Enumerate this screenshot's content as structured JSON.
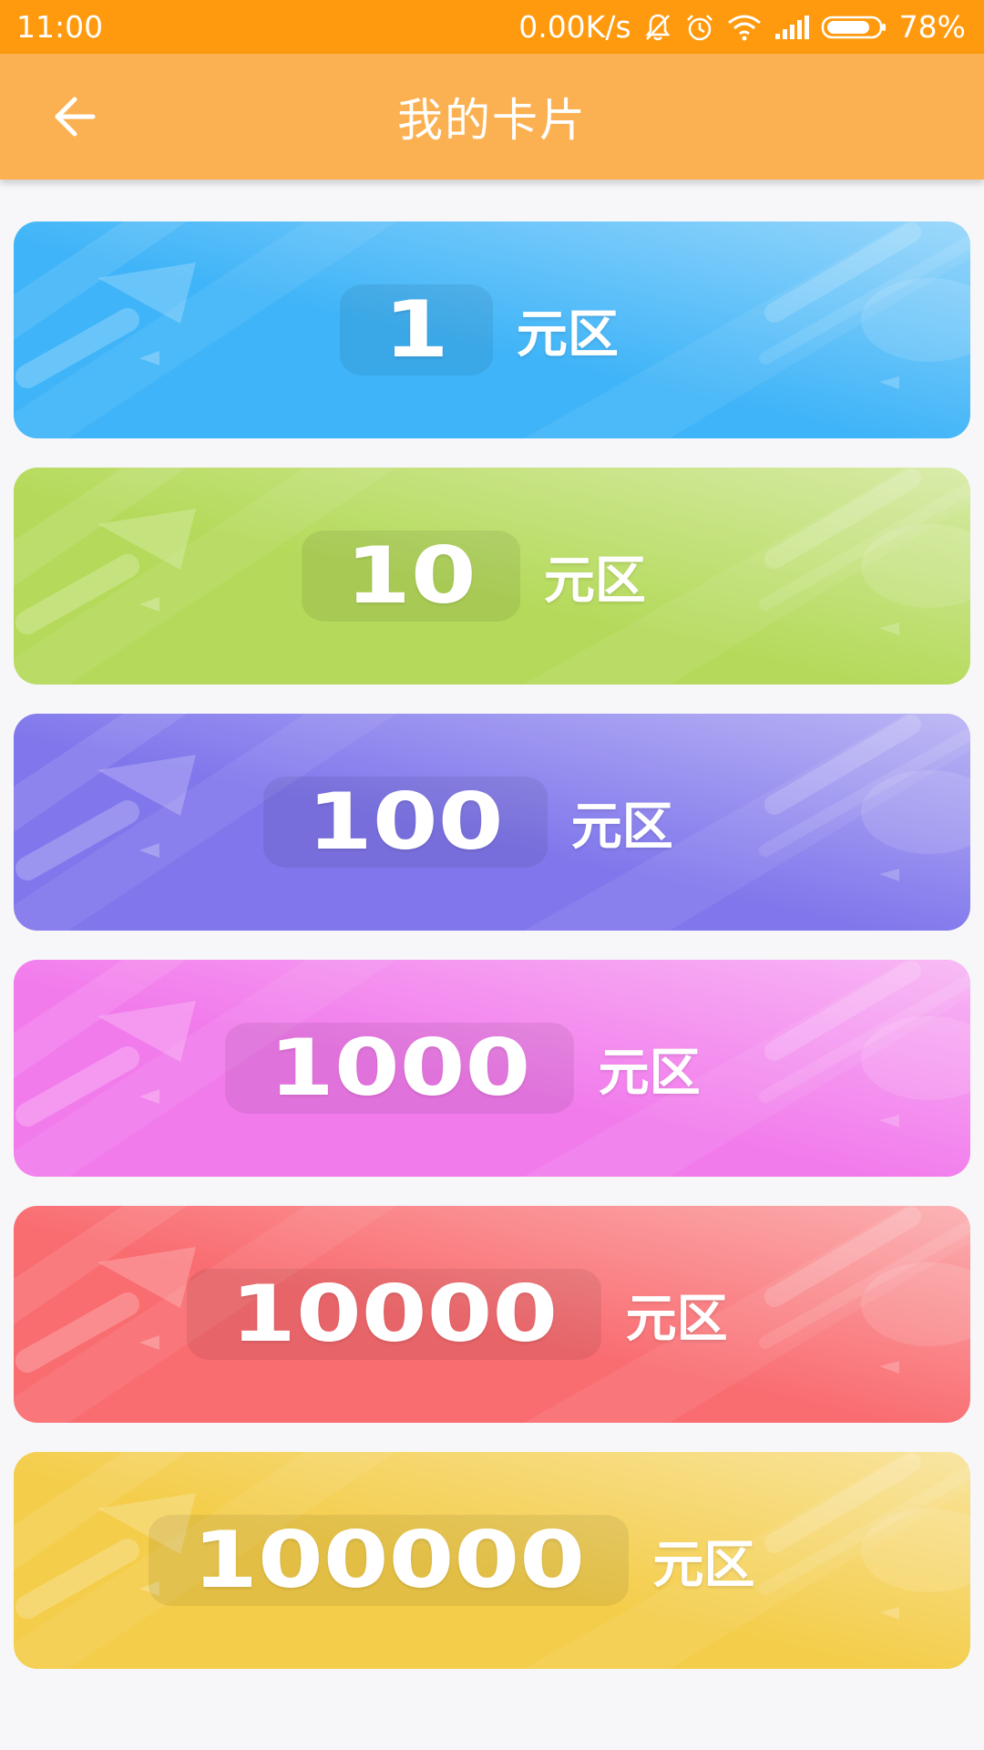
{
  "status_bar": {
    "time": "11:00",
    "network_speed": "0.00K/s",
    "battery": "78%",
    "icons": [
      "mute-bell-icon",
      "alarm-icon",
      "wifi-icon",
      "signal-icon",
      "battery-icon"
    ]
  },
  "app_bar": {
    "back_icon": "arrow-left-icon",
    "title": "我的卡片"
  },
  "cards": [
    {
      "amount": "1",
      "label": "元区",
      "color": "#3fb4f8"
    },
    {
      "amount": "10",
      "label": "元区",
      "color": "#b5da5b"
    },
    {
      "amount": "100",
      "label": "元区",
      "color": "#8077ec"
    },
    {
      "amount": "1000",
      "label": "元区",
      "color": "#f27bec"
    },
    {
      "amount": "10000",
      "label": "元区",
      "color": "#f96c70"
    },
    {
      "amount": "100000",
      "label": "元区",
      "color": "#f4cd4a"
    }
  ],
  "colors": {
    "status_bar": "#ff9a0f",
    "app_bar": "#fbb152",
    "background": "#f7f7f9"
  }
}
